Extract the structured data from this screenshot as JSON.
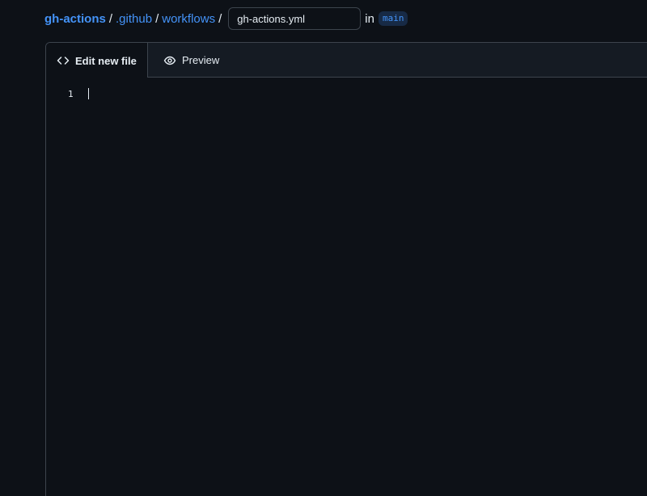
{
  "breadcrumb": {
    "repo": "gh-actions",
    "folder1": ".github",
    "folder2": "workflows",
    "separator": "/"
  },
  "filename": {
    "value": "gh-actions.yml"
  },
  "branch": {
    "in_label": "in",
    "name": "main"
  },
  "editor": {
    "tabs": [
      {
        "label": "Edit new file",
        "icon": "code-icon",
        "active": true
      },
      {
        "label": "Preview",
        "icon": "eye-icon",
        "active": false
      }
    ],
    "line_numbers": [
      "1"
    ]
  },
  "colors": {
    "background": "#0d1117",
    "link": "#4493f8",
    "border": "#3d444d"
  }
}
